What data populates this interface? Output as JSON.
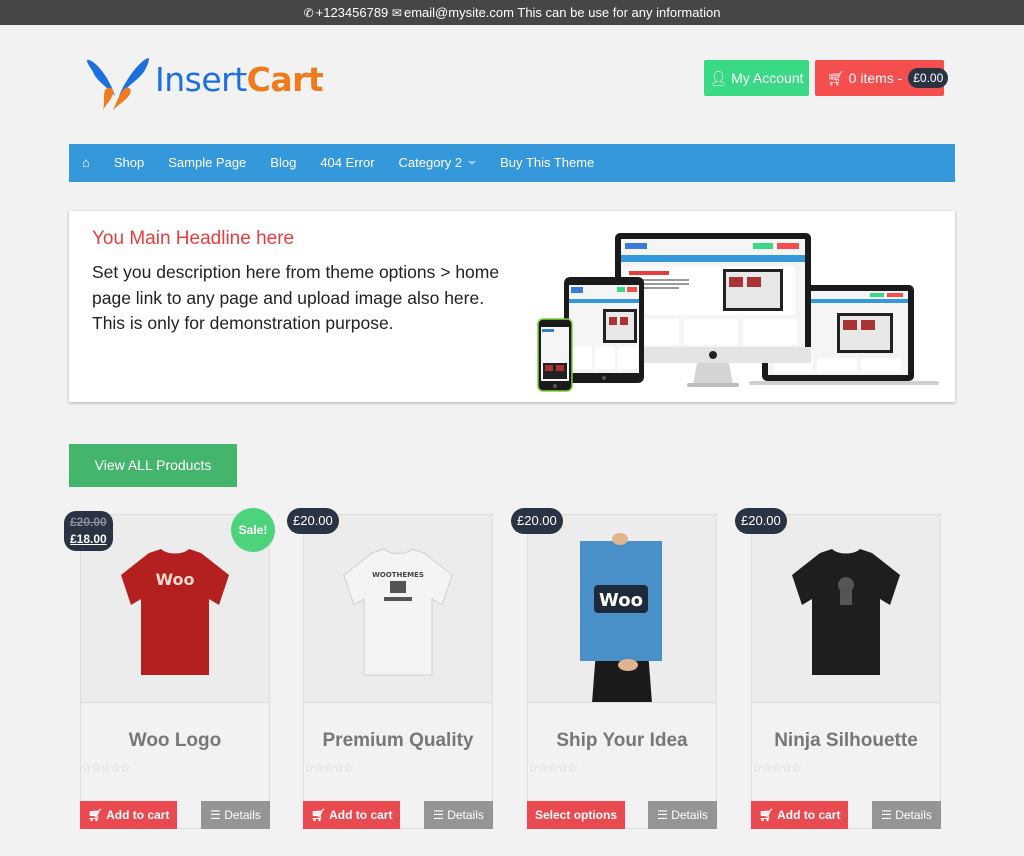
{
  "topbar": {
    "phone_icon": "phone-icon",
    "phone": "+123456789",
    "email_icon": "envelope-icon",
    "email": "email@mysite.com",
    "info": "This can be use for any information"
  },
  "logo": {
    "part1": "Insert",
    "part2": "Cart"
  },
  "header": {
    "account_label": "My Account",
    "cart_label": "0 items -",
    "cart_total": "£0.00"
  },
  "nav": {
    "items": [
      {
        "label": "Shop"
      },
      {
        "label": "Sample Page"
      },
      {
        "label": "Blog"
      },
      {
        "label": "404 Error"
      },
      {
        "label": "Category 2",
        "dropdown": true
      },
      {
        "label": "Buy This Theme"
      }
    ]
  },
  "hero": {
    "title": "You Main Headline here",
    "description": "Set you description here from theme options > home page link to any page and upload image also here. This is only for demonstration purpose."
  },
  "view_all_label": "View ALL Products",
  "colors": {
    "accent_blue": "#3498db",
    "account_green": "#3ad986",
    "cart_red": "#f44e4e",
    "view_all_green": "#43b56d",
    "badge_dark": "#2a3343",
    "add_to_cart_red": "#e84a4f",
    "details_grey": "#959595",
    "headline_red": "#e63e3e"
  },
  "products": [
    {
      "title": "Woo Logo",
      "old_price": "£20.00",
      "price": "£18.00",
      "sale": "Sale!",
      "action": "Add to cart",
      "details": "Details",
      "rating": 0
    },
    {
      "title": "Premium Quality",
      "price": "£20.00",
      "action": "Add to cart",
      "details": "Details",
      "rating": 0
    },
    {
      "title": "Ship Your Idea",
      "price": "£20.00",
      "action": "Select options",
      "details": "Details",
      "rating": 0
    },
    {
      "title": "Ninja Silhouette",
      "price": "£20.00",
      "action": "Add to cart",
      "details": "Details",
      "rating": 0
    }
  ],
  "stars_glyph": "☆☆☆☆☆"
}
